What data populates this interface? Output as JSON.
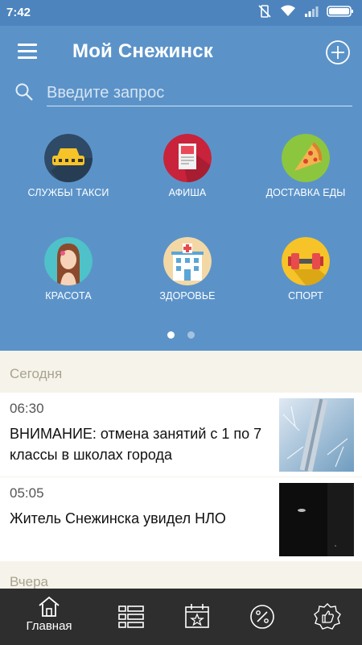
{
  "status_bar": {
    "time": "7:42"
  },
  "app_bar": {
    "title": "Мой Снежинск"
  },
  "search": {
    "placeholder": "Введите запрос"
  },
  "categories": [
    {
      "label": "СЛУЖБЫ ТАКСИ",
      "icon": "taxi-icon"
    },
    {
      "label": "АФИША",
      "icon": "poster-icon"
    },
    {
      "label": "ДОСТАВКА ЕДЫ",
      "icon": "pizza-icon"
    },
    {
      "label": "КРАСОТА",
      "icon": "beauty-icon"
    },
    {
      "label": "ЗДОРОВЬЕ",
      "icon": "hospital-icon"
    },
    {
      "label": "СПОРТ",
      "icon": "dumbbell-icon"
    }
  ],
  "pager": {
    "pages": 2,
    "active": 1
  },
  "sections": {
    "today": "Сегодня",
    "yesterday": "Вчера"
  },
  "news": [
    {
      "time": "06:30",
      "headline": "ВНИМАНИЕ: отмена занятий с 1 по 7 классы в школах города",
      "thumb": "frost-thermometer-image"
    },
    {
      "time": "05:05",
      "headline": "Житель Снежинска увидел НЛО",
      "thumb": "night-sky-ufo-image"
    }
  ],
  "bottom_nav": [
    {
      "label": "Главная",
      "icon": "home-icon",
      "active": true
    },
    {
      "label": "",
      "icon": "list-icon",
      "active": false
    },
    {
      "label": "",
      "icon": "calendar-star-icon",
      "active": false
    },
    {
      "label": "",
      "icon": "percent-icon",
      "active": false
    },
    {
      "label": "",
      "icon": "thumbs-up-badge-icon",
      "active": false
    }
  ],
  "colors": {
    "header_bg": "#5b93c9",
    "status_bg": "#4d84bd",
    "page_bg": "#f6f3ea",
    "bottom_nav_bg": "#2e2e2e"
  }
}
